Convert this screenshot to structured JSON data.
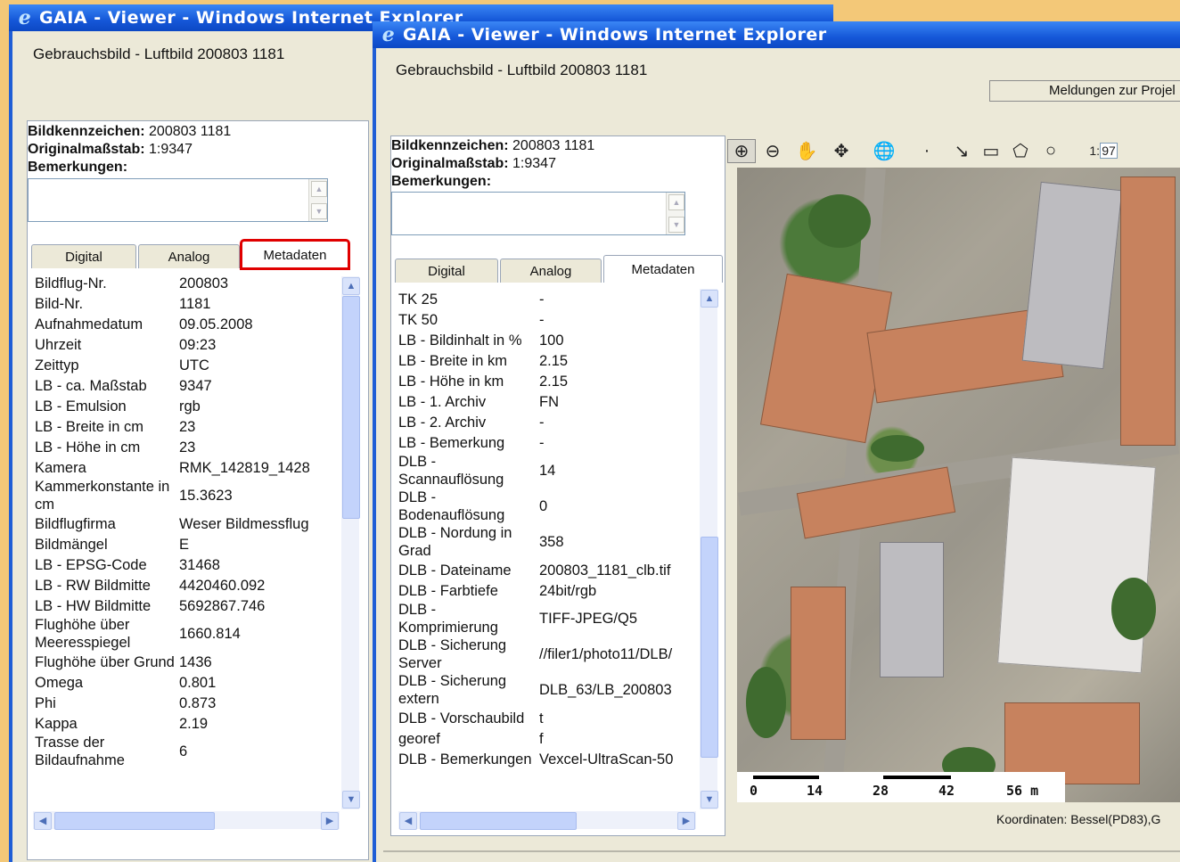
{
  "windows": {
    "back": {
      "title": "GAIA - Viewer - Windows Internet Explorer",
      "caption": "Gebrauchsbild - Luftbild 200803 1181",
      "info": {
        "bildkennzeichen_label": "Bildkennzeichen:",
        "bildkennzeichen_value": "200803 1181",
        "originalmassstab_label": "Originalmaßstab:",
        "originalmassstab_value": "1:9347",
        "bemerkungen_label": "Bemerkungen:"
      },
      "tabs": [
        "Digital",
        "Analog",
        "Metadaten"
      ],
      "active_tab": "Metadaten",
      "highlight_color": "#e00000",
      "rows": [
        {
          "k": "Bildflug-Nr.",
          "v": "200803"
        },
        {
          "k": "Bild-Nr.",
          "v": "1181"
        },
        {
          "k": "Aufnahmedatum",
          "v": "09.05.2008"
        },
        {
          "k": "Uhrzeit",
          "v": "09:23"
        },
        {
          "k": "Zeittyp",
          "v": "UTC"
        },
        {
          "k": "LB - ca. Maßstab",
          "v": "9347"
        },
        {
          "k": "LB - Emulsion",
          "v": "rgb"
        },
        {
          "k": "LB - Breite in cm",
          "v": "23"
        },
        {
          "k": "LB - Höhe in cm",
          "v": "23"
        },
        {
          "k": "Kamera",
          "v": "RMK_142819_1428"
        },
        {
          "k": "Kammerkonstante in cm",
          "v": "15.3623"
        },
        {
          "k": "Bildflugfirma",
          "v": "Weser Bildmessflug"
        },
        {
          "k": "Bildmängel",
          "v": "E"
        },
        {
          "k": "LB - EPSG-Code",
          "v": "31468"
        },
        {
          "k": "LB - RW Bildmitte",
          "v": "4420460.092"
        },
        {
          "k": "LB - HW Bildmitte",
          "v": "5692867.746"
        },
        {
          "k": "Flughöhe über Meeresspiegel",
          "v": "1660.814"
        },
        {
          "k": "Flughöhe über Grund",
          "v": "1436"
        },
        {
          "k": "Omega",
          "v": "0.801"
        },
        {
          "k": "Phi",
          "v": "0.873"
        },
        {
          "k": "Kappa",
          "v": "2.19"
        },
        {
          "k": "Trasse der Bildaufnahme",
          "v": "6"
        }
      ]
    },
    "front": {
      "title": "GAIA - Viewer - Windows Internet Explorer",
      "caption": "Gebrauchsbild - Luftbild 200803 1181",
      "meldungen_button": "Meldungen zur Projel",
      "info": {
        "bildkennzeichen_label": "Bildkennzeichen:",
        "bildkennzeichen_value": "200803 1181",
        "originalmassstab_label": "Originalmaßstab:",
        "originalmassstab_value": "1:9347",
        "bemerkungen_label": "Bemerkungen:"
      },
      "tabs": [
        "Digital",
        "Analog",
        "Metadaten"
      ],
      "active_tab": "Metadaten",
      "rows": [
        {
          "k": "TK 25",
          "v": "-"
        },
        {
          "k": "TK 50",
          "v": "-"
        },
        {
          "k": "LB - Bildinhalt in %",
          "v": "100"
        },
        {
          "k": "LB - Breite in km",
          "v": "2.15"
        },
        {
          "k": "LB - Höhe in km",
          "v": "2.15"
        },
        {
          "k": "LB - 1. Archiv",
          "v": "FN"
        },
        {
          "k": "LB - 2. Archiv",
          "v": "-"
        },
        {
          "k": "LB - Bemerkung",
          "v": "-"
        },
        {
          "k": "DLB - Scannauflösung",
          "v": "14"
        },
        {
          "k": "DLB - Bodenauflösung",
          "v": "0"
        },
        {
          "k": "DLB - Nordung in Grad",
          "v": "358"
        },
        {
          "k": "DLB - Dateiname",
          "v": "200803_1181_clb.tif"
        },
        {
          "k": "DLB - Farbtiefe",
          "v": "24bit/rgb"
        },
        {
          "k": "DLB - Komprimierung",
          "v": "TIFF-JPEG/Q5"
        },
        {
          "k": "DLB - Sicherung Server",
          "v": "//filer1/photo11/DLB/"
        },
        {
          "k": "DLB - Sicherung extern",
          "v": "DLB_63/LB_200803"
        },
        {
          "k": "DLB - Vorschaubild",
          "v": "t"
        },
        {
          "k": "georef",
          "v": "f"
        },
        {
          "k": "DLB - Bemerkungen",
          "v": "Vexcel-UltraScan-50"
        }
      ],
      "map": {
        "scale_prefix": "1:",
        "scale_value": "97",
        "scale_labels": [
          "0",
          "14",
          "28",
          "42",
          "56 m"
        ],
        "coords_text": "Koordinaten: Bessel(PD83),G"
      }
    }
  }
}
